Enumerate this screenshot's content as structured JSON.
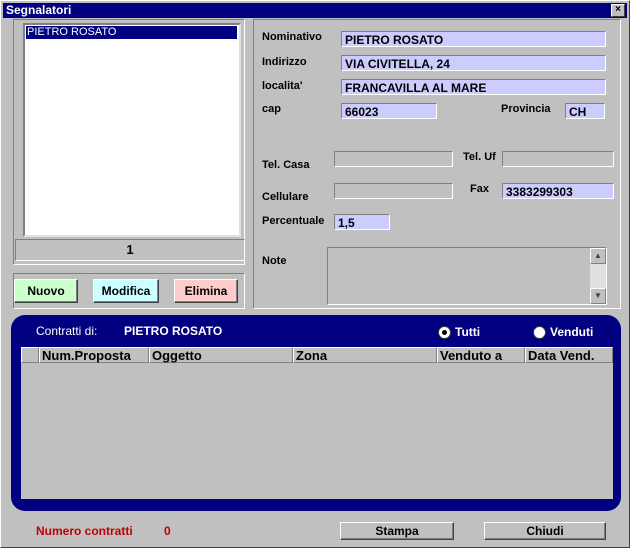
{
  "window": {
    "title": "Segnalatori",
    "close_glyph": "×"
  },
  "list": {
    "items": [
      "PIETRO ROSATO"
    ],
    "count": "1"
  },
  "buttons": {
    "nuovo": "Nuovo",
    "modifica": "Modifica",
    "elimina": "Elimina",
    "stampa": "Stampa",
    "chiudi": "Chiudi"
  },
  "form": {
    "nominativo_label": "Nominativo",
    "nominativo": "PIETRO ROSATO",
    "indirizzo_label": "Indirizzo",
    "indirizzo": "VIA CIVITELLA, 24",
    "localita_label": "localita'",
    "localita": "FRANCAVILLA AL MARE",
    "cap_label": "cap",
    "cap": "66023",
    "provincia_label": "Provincia",
    "provincia": "CH",
    "tel_casa_label": "Tel. Casa",
    "tel_casa": "",
    "tel_uf_label": "Tel. Uf",
    "tel_uf": "",
    "cellulare_label": "Cellulare",
    "cellulare": "",
    "fax_label": "Fax",
    "fax": "3383299303",
    "percentuale_label": "Percentuale",
    "percentuale": "1,5",
    "note_label": "Note",
    "note": ""
  },
  "contracts": {
    "title_label": "Contratti di:",
    "owner": "PIETRO ROSATO",
    "filter_all": "Tutti",
    "filter_sold": "Venduti",
    "selected_filter": "Tutti",
    "columns": [
      "Num.Proposta",
      "Oggetto",
      "Zona",
      "Venduto a",
      "Data Vend."
    ],
    "rows": []
  },
  "footer": {
    "count_label": "Numero contratti",
    "count": "0"
  },
  "colors": {
    "title_bar": "#000080",
    "field_bg": "#ccccff",
    "nuovo_bg": "#ccffcc",
    "modifica_bg": "#ccffff",
    "elimina_bg": "#ffcccc",
    "footer_text": "#c00000"
  }
}
